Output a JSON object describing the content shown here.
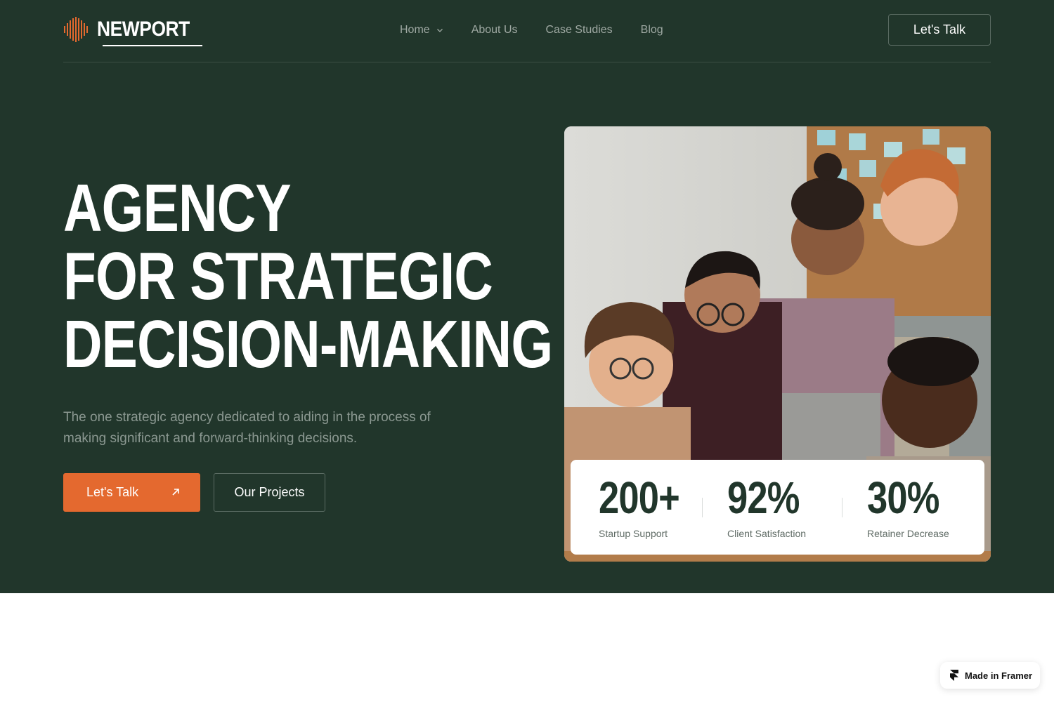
{
  "brand": {
    "name": "NEWPORT",
    "logo_icon": "soundwave-icon",
    "accent_color": "#e4692f",
    "background_color": "#21362b"
  },
  "nav": {
    "items": [
      {
        "label": "Home",
        "has_dropdown": true
      },
      {
        "label": "About Us"
      },
      {
        "label": "Case Studies"
      },
      {
        "label": "Blog"
      }
    ],
    "cta_label": "Let's Talk"
  },
  "hero": {
    "headline_lines": [
      "AGENCY",
      "FOR STRATEGIC",
      "DECISION-MAKING"
    ],
    "subtext": "The one strategic agency dedicated to aiding in the process of making significant and forward-thinking decisions.",
    "primary_button": "Let's Talk",
    "primary_button_icon": "arrow-up-right-icon",
    "secondary_button": "Our Projects"
  },
  "stats": [
    {
      "value": "200+",
      "label": "Startup Support"
    },
    {
      "value": "92%",
      "label": "Client Satisfaction"
    },
    {
      "value": "30%",
      "label": "Retainer Decrease"
    }
  ],
  "badge": {
    "label": "Made in Framer",
    "icon": "framer-icon"
  }
}
